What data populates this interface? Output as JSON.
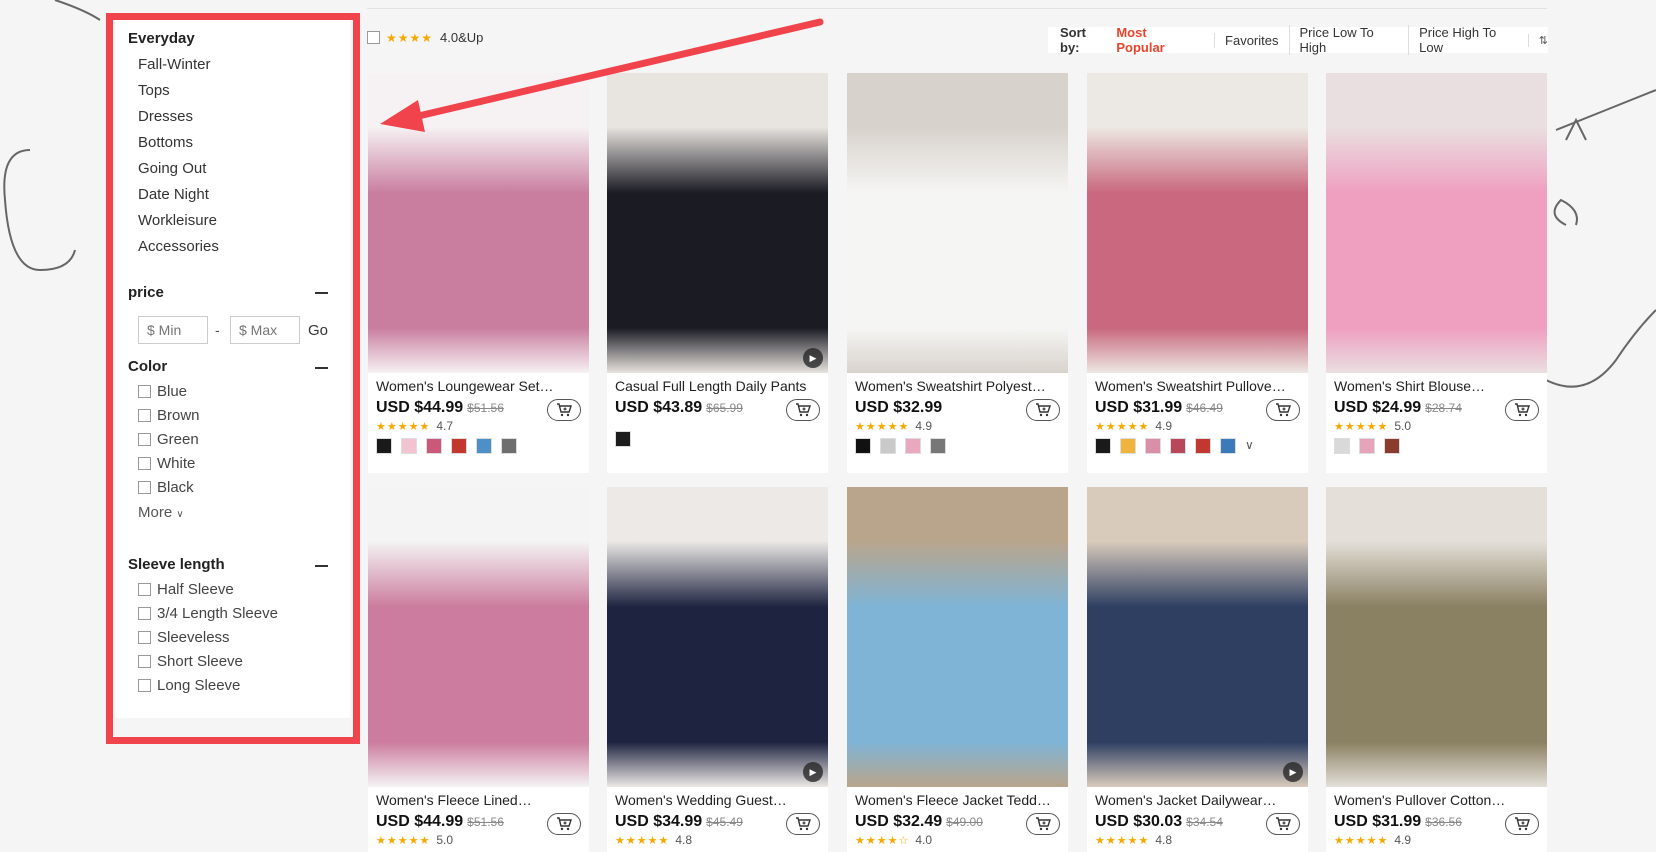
{
  "sidebar": {
    "category_heading": "Everyday",
    "categories": [
      "Fall-Winter",
      "Tops",
      "Dresses",
      "Bottoms",
      "Going Out",
      "Date Night",
      "Workleisure",
      "Accessories"
    ],
    "price_heading": "price",
    "price_min_placeholder": "$ Min",
    "price_max_placeholder": "$ Max",
    "price_dash": "-",
    "price_go": "Go",
    "color_heading": "Color",
    "colors": [
      "Blue",
      "Brown",
      "Green",
      "White",
      "Black"
    ],
    "color_more": "More",
    "sleeve_heading": "Sleeve length",
    "sleeves": [
      "Half Sleeve",
      "3/4 Length Sleeve",
      "Sleeveless",
      "Short Sleeve",
      "Long Sleeve"
    ]
  },
  "toolbar": {
    "rating_filter_label": "4.0&Up",
    "sort_label": "Sort by:",
    "sort_options": [
      "Most Popular",
      "Favorites",
      "Price Low To High",
      "Price High To Low"
    ],
    "sort_active": "Most Popular"
  },
  "products": [
    {
      "title": "Women's Loungewear Set…",
      "price": "USD $44.99",
      "old_price": "$51.56",
      "rating": "4.7",
      "stars": 5,
      "video": false,
      "swatches": [
        "#1a1a1a",
        "#f2c4d2",
        "#c9587a",
        "#c2372f",
        "#4d8fc6",
        "#6e6e6e"
      ],
      "img_colors": [
        "#f6f2f3",
        "#c97ea0"
      ]
    },
    {
      "title": "Casual Full Length Daily Pants",
      "price": "USD $43.89",
      "old_price": "$65.99",
      "rating": "",
      "stars": 0,
      "video": true,
      "swatches": [
        "#1c1c1c"
      ],
      "img_colors": [
        "#e8e4df",
        "#1b1b24"
      ]
    },
    {
      "title": "Women's Sweatshirt Polyest…",
      "price": "USD $32.99",
      "old_price": "",
      "rating": "4.9",
      "stars": 5,
      "video": false,
      "swatches": [
        "#111111",
        "#c9c9c9",
        "#e8a8be",
        "#777777"
      ],
      "img_colors": [
        "#d8d2cc",
        "#f5f5f3"
      ]
    },
    {
      "title": "Women's Sweatshirt Pullove…",
      "price": "USD $31.99",
      "old_price": "$46.49",
      "rating": "4.9",
      "stars": 5,
      "video": false,
      "swatches": [
        "#1a1a1a",
        "#f0b43c",
        "#d98fa8",
        "#b8475a",
        "#c2372f",
        "#3b79b8"
      ],
      "swatch_more": "∨",
      "img_colors": [
        "#ece8e3",
        "#c9687e"
      ]
    },
    {
      "title": "Women's Shirt Blouse…",
      "price": "USD $24.99",
      "old_price": "$28.74",
      "rating": "5.0",
      "stars": 5,
      "video": false,
      "swatches": [
        "#d9d9d9",
        "#e7a3ba",
        "#8a3b2d"
      ],
      "img_colors": [
        "#e9dfe0",
        "#ef9fc0"
      ]
    },
    {
      "title": "Women's Fleece Lined…",
      "price": "USD $44.99",
      "old_price": "$51.56",
      "rating": "5.0",
      "stars": 5,
      "video": false,
      "swatches": [],
      "img_colors": [
        "#f4f4f4",
        "#cc7c9e"
      ]
    },
    {
      "title": "Women's Wedding Guest…",
      "price": "USD $34.99",
      "old_price": "$45.49",
      "rating": "4.8",
      "stars": 5,
      "video": true,
      "swatches": [],
      "img_colors": [
        "#ece9e6",
        "#1e2340"
      ]
    },
    {
      "title": "Women's Fleece Jacket Tedd…",
      "price": "USD $32.49",
      "old_price": "$49.00",
      "rating": "4.0",
      "stars": 4,
      "video": false,
      "swatches": [],
      "img_colors": [
        "#b9a58c",
        "#7fb4d6"
      ]
    },
    {
      "title": "Women's Jacket Dailywear…",
      "price": "USD $30.03",
      "old_price": "$34.54",
      "rating": "4.8",
      "stars": 5,
      "video": true,
      "swatches": [],
      "img_colors": [
        "#d9cbbc",
        "#2e3f62"
      ]
    },
    {
      "title": "Women's Pullover Cotton…",
      "price": "USD $31.99",
      "old_price": "$36.56",
      "rating": "4.9",
      "stars": 5,
      "video": false,
      "swatches": [],
      "img_colors": [
        "#e4e0d9",
        "#8a8062"
      ]
    }
  ],
  "icons": {
    "cart": "cart-icon",
    "play": "play-icon",
    "star": "star-icon"
  },
  "colors": {
    "accent_red": "#e8442c",
    "highlight_border": "#f0434b",
    "star": "#f7a800"
  }
}
